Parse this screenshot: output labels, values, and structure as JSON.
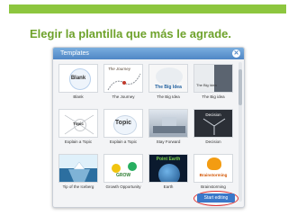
{
  "slide": {
    "title": "Elegir la plantilla que más le agrade."
  },
  "dialog": {
    "title": "Templates",
    "close_icon": "close-icon",
    "start_button": "Start editing",
    "templates": [
      {
        "caption": "Blank",
        "thumb_text": "Blank"
      },
      {
        "caption": "The Journey",
        "thumb_text": "The Journey"
      },
      {
        "caption": "The Big Idea",
        "thumb_text": "The Big Idea"
      },
      {
        "caption": "The Big idea",
        "thumb_text": "The Big Idea"
      },
      {
        "caption": "Explain a Topic",
        "thumb_text": "Topic"
      },
      {
        "caption": "Explain a Topic",
        "thumb_text": "Topic"
      },
      {
        "caption": "Stay Forward",
        "thumb_text": ""
      },
      {
        "caption": "Decision",
        "thumb_text": "Decision"
      },
      {
        "caption": "Tip of the Iceberg",
        "thumb_text": ""
      },
      {
        "caption": "Growth Opportunity",
        "thumb_text": "GROW"
      },
      {
        "caption": "Earth",
        "thumb_text": "Point Earth"
      },
      {
        "caption": "Brainstorming",
        "thumb_text": "Brainstorming"
      }
    ]
  }
}
